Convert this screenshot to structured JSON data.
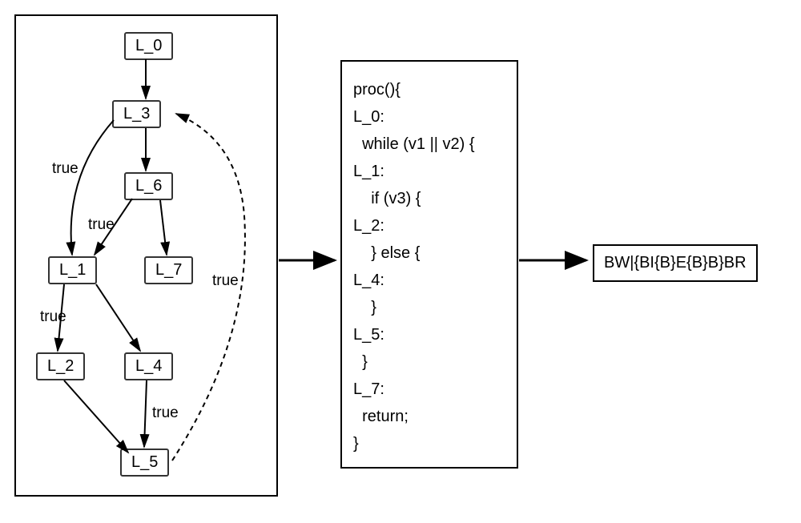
{
  "graph": {
    "nodes": {
      "L0": "L_0",
      "L3": "L_3",
      "L6": "L_6",
      "L1": "L_1",
      "L7": "L_7",
      "L2": "L_2",
      "L4": "L_4",
      "L5": "L_5"
    },
    "edge_labels": {
      "L3_L1": "true",
      "L6_L1": "true",
      "L1_L2": "true",
      "L4_L5": "true",
      "L5_L3": "true"
    }
  },
  "code": {
    "l0": "proc(){",
    "l1": "L_0:",
    "l2": "  while (v1 || v2) {",
    "l3": "L_1:",
    "l4": "    if (v3) {",
    "l5": "L_2:",
    "l6": "    } else {",
    "l7": "L_4:",
    "l8": "    }",
    "l9": "L_5:",
    "l10": "  }",
    "l11": "L_7:",
    "l12": "  return;",
    "l13": "}"
  },
  "output": {
    "text": "BW|{BI{B}E{B}B}BR"
  }
}
